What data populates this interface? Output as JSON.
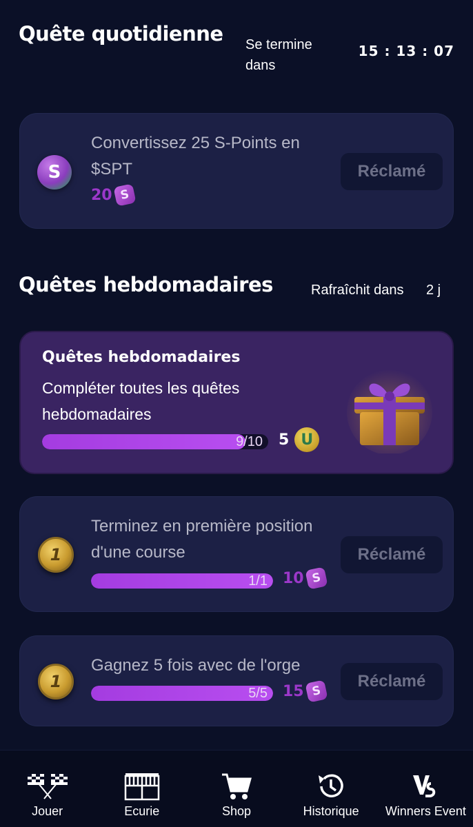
{
  "daily": {
    "title": "Quête quotidienne",
    "ends_label": "Se termine dans",
    "timer": "15 : 13 : 07"
  },
  "daily_quests": [
    {
      "label": "Convertissez 25 S-Points en $SPT",
      "reward": "20",
      "button": "Réclamé",
      "icon": "s-point-icon"
    }
  ],
  "weekly": {
    "title": "Quêtes hebdomadaires",
    "refresh_label": "Rafraîchit dans",
    "refresh_value": "2 j"
  },
  "featured": {
    "title": "Quêtes hebdomadaires",
    "description": "Compléter toutes les quêtes hebdomadaires",
    "progress_text": "9/10",
    "progress": 0.9,
    "reward": "5",
    "reward_icon": "horseshoe-coin-icon"
  },
  "weekly_quests": [
    {
      "label": "Terminez en première position d'une course",
      "progress_text": "1/1",
      "progress": 1.0,
      "reward": "10",
      "button": "Réclamé",
      "icon": "first-place-coin-icon"
    },
    {
      "label": "Gagnez 5 fois avec de l'orge",
      "progress_text": "5/5",
      "progress": 1.0,
      "reward": "15",
      "button": "Réclamé",
      "icon": "first-place-coin-icon"
    }
  ],
  "nav": [
    {
      "label": "Jouer",
      "icon": "checkered-flags-icon"
    },
    {
      "label": "Ecurie",
      "icon": "stable-doors-icon"
    },
    {
      "label": "Shop",
      "icon": "cart-icon"
    },
    {
      "label": "Historique",
      "icon": "history-icon"
    },
    {
      "label": "Winners Event",
      "icon": "vs-icon"
    }
  ],
  "colors": {
    "background": "#0b1027",
    "card": "#1c2045",
    "featured_card": "#3a2462",
    "progress": "#b84ef0",
    "reward_purple": "#9b38c9"
  }
}
